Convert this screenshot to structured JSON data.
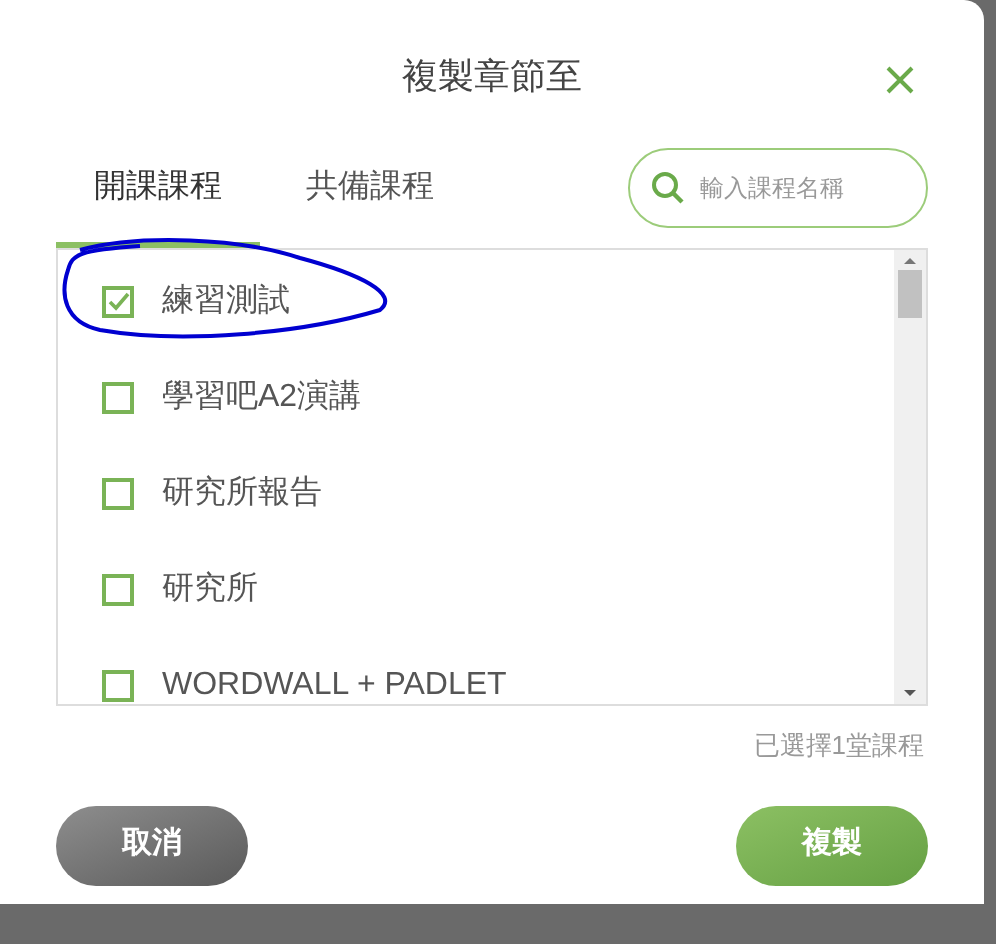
{
  "dialog": {
    "title": "複製章節至"
  },
  "tabs": [
    {
      "label": "開課課程",
      "selected": true
    },
    {
      "label": "共備課程",
      "selected": false
    }
  ],
  "search": {
    "placeholder": "輸入課程名稱"
  },
  "courses": [
    {
      "name": "練習測試",
      "checked": true
    },
    {
      "name": "學習吧A2演講",
      "checked": false
    },
    {
      "name": "研究所報告",
      "checked": false
    },
    {
      "name": "研究所",
      "checked": false
    },
    {
      "name": "WORDWALL + PADLET",
      "checked": false
    }
  ],
  "selection_count": "已選擇1堂課程",
  "buttons": {
    "cancel": "取消",
    "confirm": "複製"
  }
}
